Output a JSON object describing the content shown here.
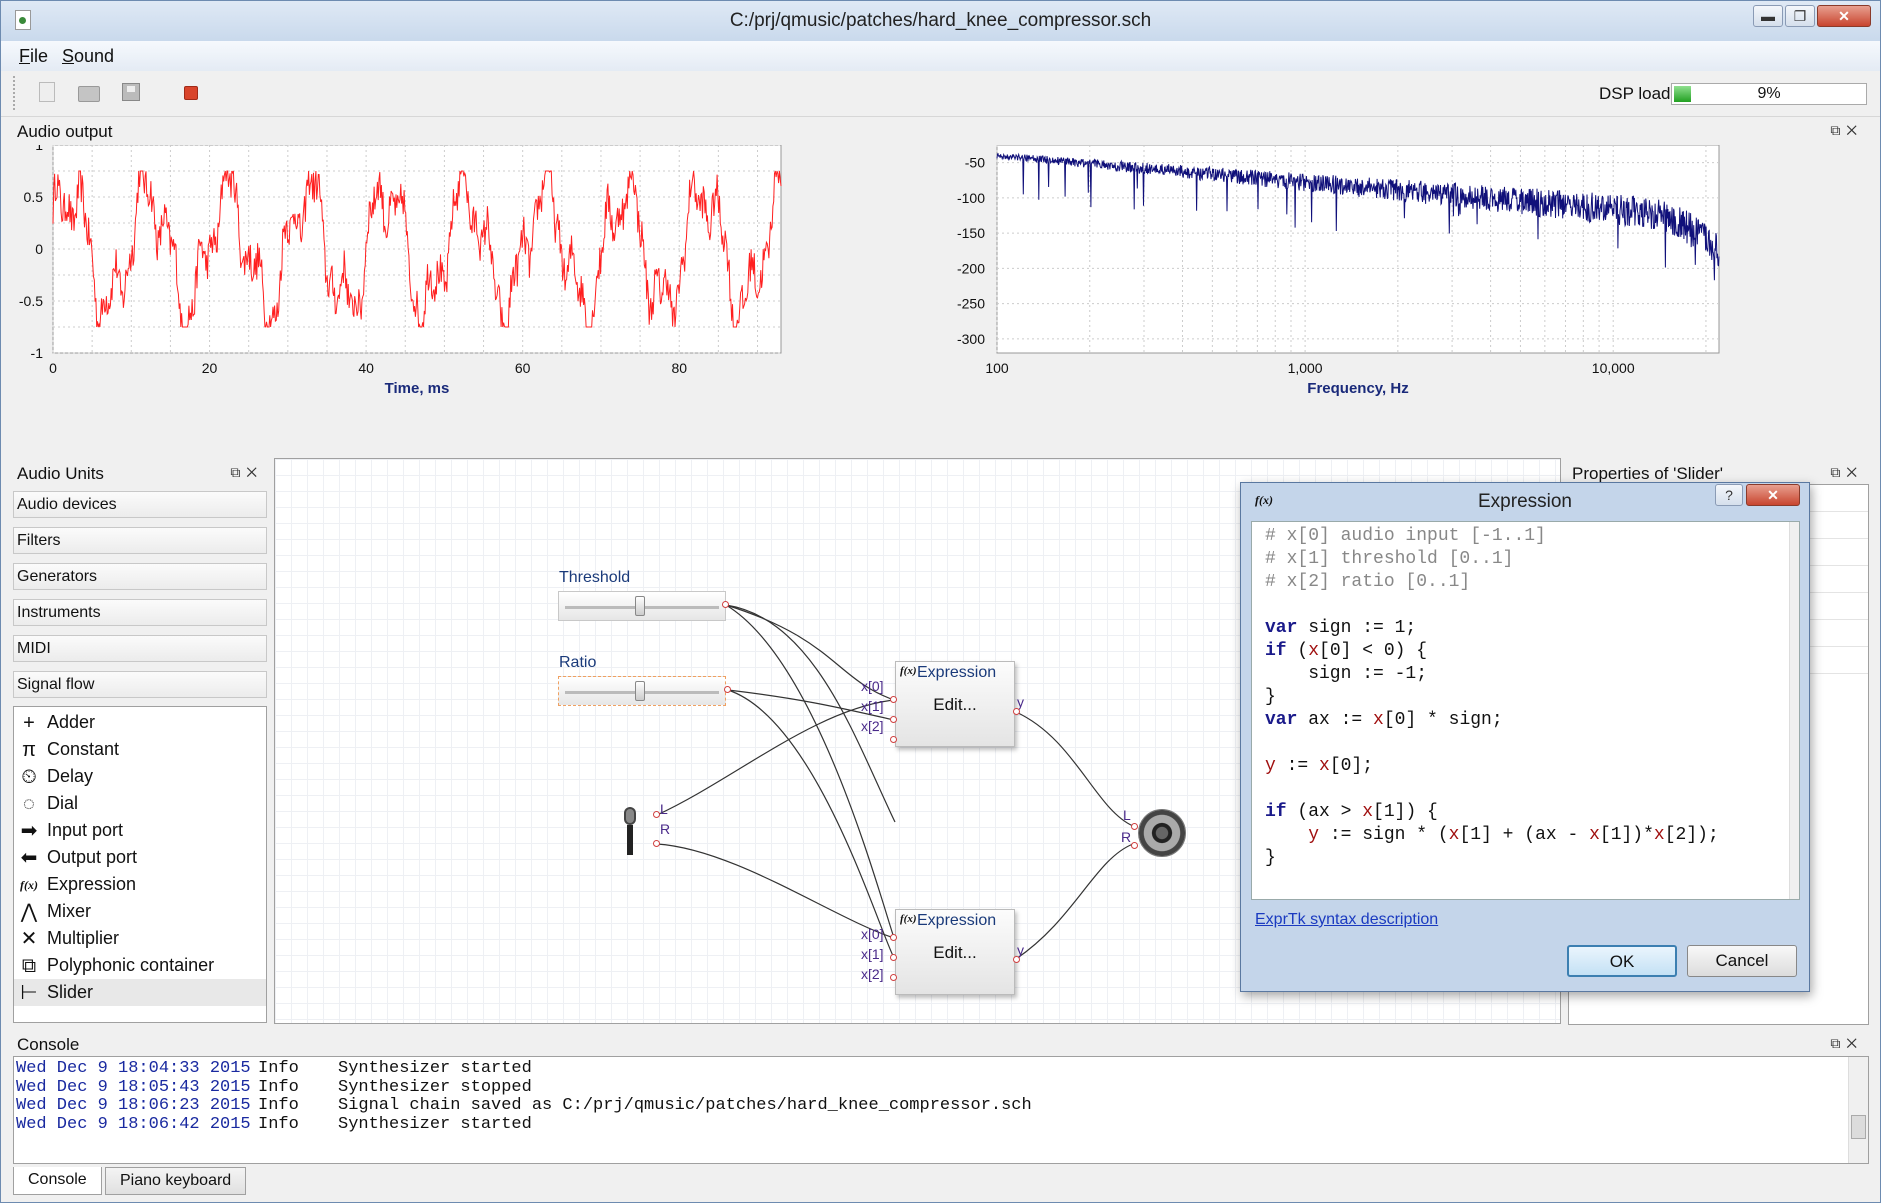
{
  "window": {
    "title": "C:/prj/qmusic/patches/hard_knee_compressor.sch"
  },
  "menu": {
    "file": "File",
    "file_key": "F",
    "file_rest": "ile",
    "sound": "Sound",
    "sound_key": "S",
    "sound_rest": "ound"
  },
  "toolbar": {
    "buttons": [
      "new-document-icon",
      "open-folder-icon",
      "save-icon",
      "stop-icon"
    ],
    "dsp_label": "DSP load",
    "dsp_value": "9%",
    "dsp_fraction": 0.09
  },
  "audio_output": {
    "title": "Audio output",
    "time_plot": {
      "xlabel": "Time, ms",
      "x_ticks": [
        "0",
        "20",
        "40",
        "60",
        "80"
      ],
      "y_ticks": [
        "1",
        "0.5",
        "0",
        "-0.5",
        "-1"
      ],
      "xlim": [
        0,
        93
      ],
      "ylim": [
        -1,
        1
      ],
      "color": "#ff2020"
    },
    "spectrum_plot": {
      "xlabel": "Frequency, Hz",
      "x_ticks": [
        "100",
        "1,000",
        "10,000"
      ],
      "y_ticks": [
        "-50",
        "-100",
        "-150",
        "-200",
        "-250",
        "-300"
      ],
      "xlim": [
        100,
        22050
      ],
      "ylim": [
        -320,
        -25
      ],
      "color": "#10107a"
    }
  },
  "audio_units": {
    "title": "Audio Units",
    "categories": [
      "Audio devices",
      "Filters",
      "Generators",
      "Instruments",
      "MIDI",
      "Signal flow"
    ],
    "items": [
      {
        "label": "Adder",
        "icon": "+"
      },
      {
        "label": "Constant",
        "icon": "π"
      },
      {
        "label": "Delay",
        "icon": "⏲"
      },
      {
        "label": "Dial",
        "icon": "◌"
      },
      {
        "label": "Input port",
        "icon": "➡"
      },
      {
        "label": "Output port",
        "icon": "⬅"
      },
      {
        "label": "Expression",
        "icon": "f(x)"
      },
      {
        "label": "Mixer",
        "icon": "⋀"
      },
      {
        "label": "Multiplier",
        "icon": "✕"
      },
      {
        "label": "Polyphonic container",
        "icon": "⧉"
      },
      {
        "label": "Slider",
        "icon": "⊢"
      }
    ],
    "selected_item": "Slider"
  },
  "schema": {
    "threshold": {
      "caption": "Threshold",
      "value": 0.48
    },
    "ratio": {
      "caption": "Ratio",
      "value": 0.48
    },
    "expr_top": {
      "caption": "Expression",
      "edit": "Edit...",
      "inputs": [
        "x[0]",
        "x[1]",
        "x[2]"
      ],
      "output": "y"
    },
    "expr_bottom": {
      "caption": "Expression",
      "edit": "Edit...",
      "inputs": [
        "x[0]",
        "x[1]",
        "x[2]"
      ],
      "output": "y"
    },
    "mic_ports": [
      "L",
      "R"
    ],
    "speaker_ports": [
      "L",
      "R"
    ]
  },
  "properties": {
    "title": "Properties of 'Slider'"
  },
  "expression_dialog": {
    "title": "Expression",
    "help_button": "?",
    "close_button": "✕",
    "code": [
      "# x[0] audio input [-1..1]",
      "# x[1] threshold [0..1]",
      "# x[2] ratio [0..1]",
      "",
      "var sign := 1;",
      "if (x[0] < 0) {",
      "    sign := -1;",
      "}",
      "var ax := x[0] * sign;",
      "",
      "y := x[0];",
      "",
      "if (ax > x[1]) {",
      "    y := sign * (x[1] + (ax - x[1])*x[2]);",
      "}"
    ],
    "link": "ExprTk syntax description",
    "ok": "OK",
    "cancel": "Cancel"
  },
  "console": {
    "title": "Console",
    "lines": [
      {
        "date": "Wed Dec 9 18:04:33 2015",
        "level": "Info",
        "message": "Synthesizer started"
      },
      {
        "date": "Wed Dec 9 18:05:43 2015",
        "level": "Info",
        "message": "Synthesizer stopped"
      },
      {
        "date": "Wed Dec 9 18:06:23 2015",
        "level": "Info",
        "message": "Signal chain saved as C:/prj/qmusic/patches/hard_knee_compressor.sch"
      },
      {
        "date": "Wed Dec 9 18:06:42 2015",
        "level": "Info",
        "message": "Synthesizer started"
      }
    ]
  },
  "bottom_tabs": [
    "Console",
    "Piano keyboard"
  ]
}
